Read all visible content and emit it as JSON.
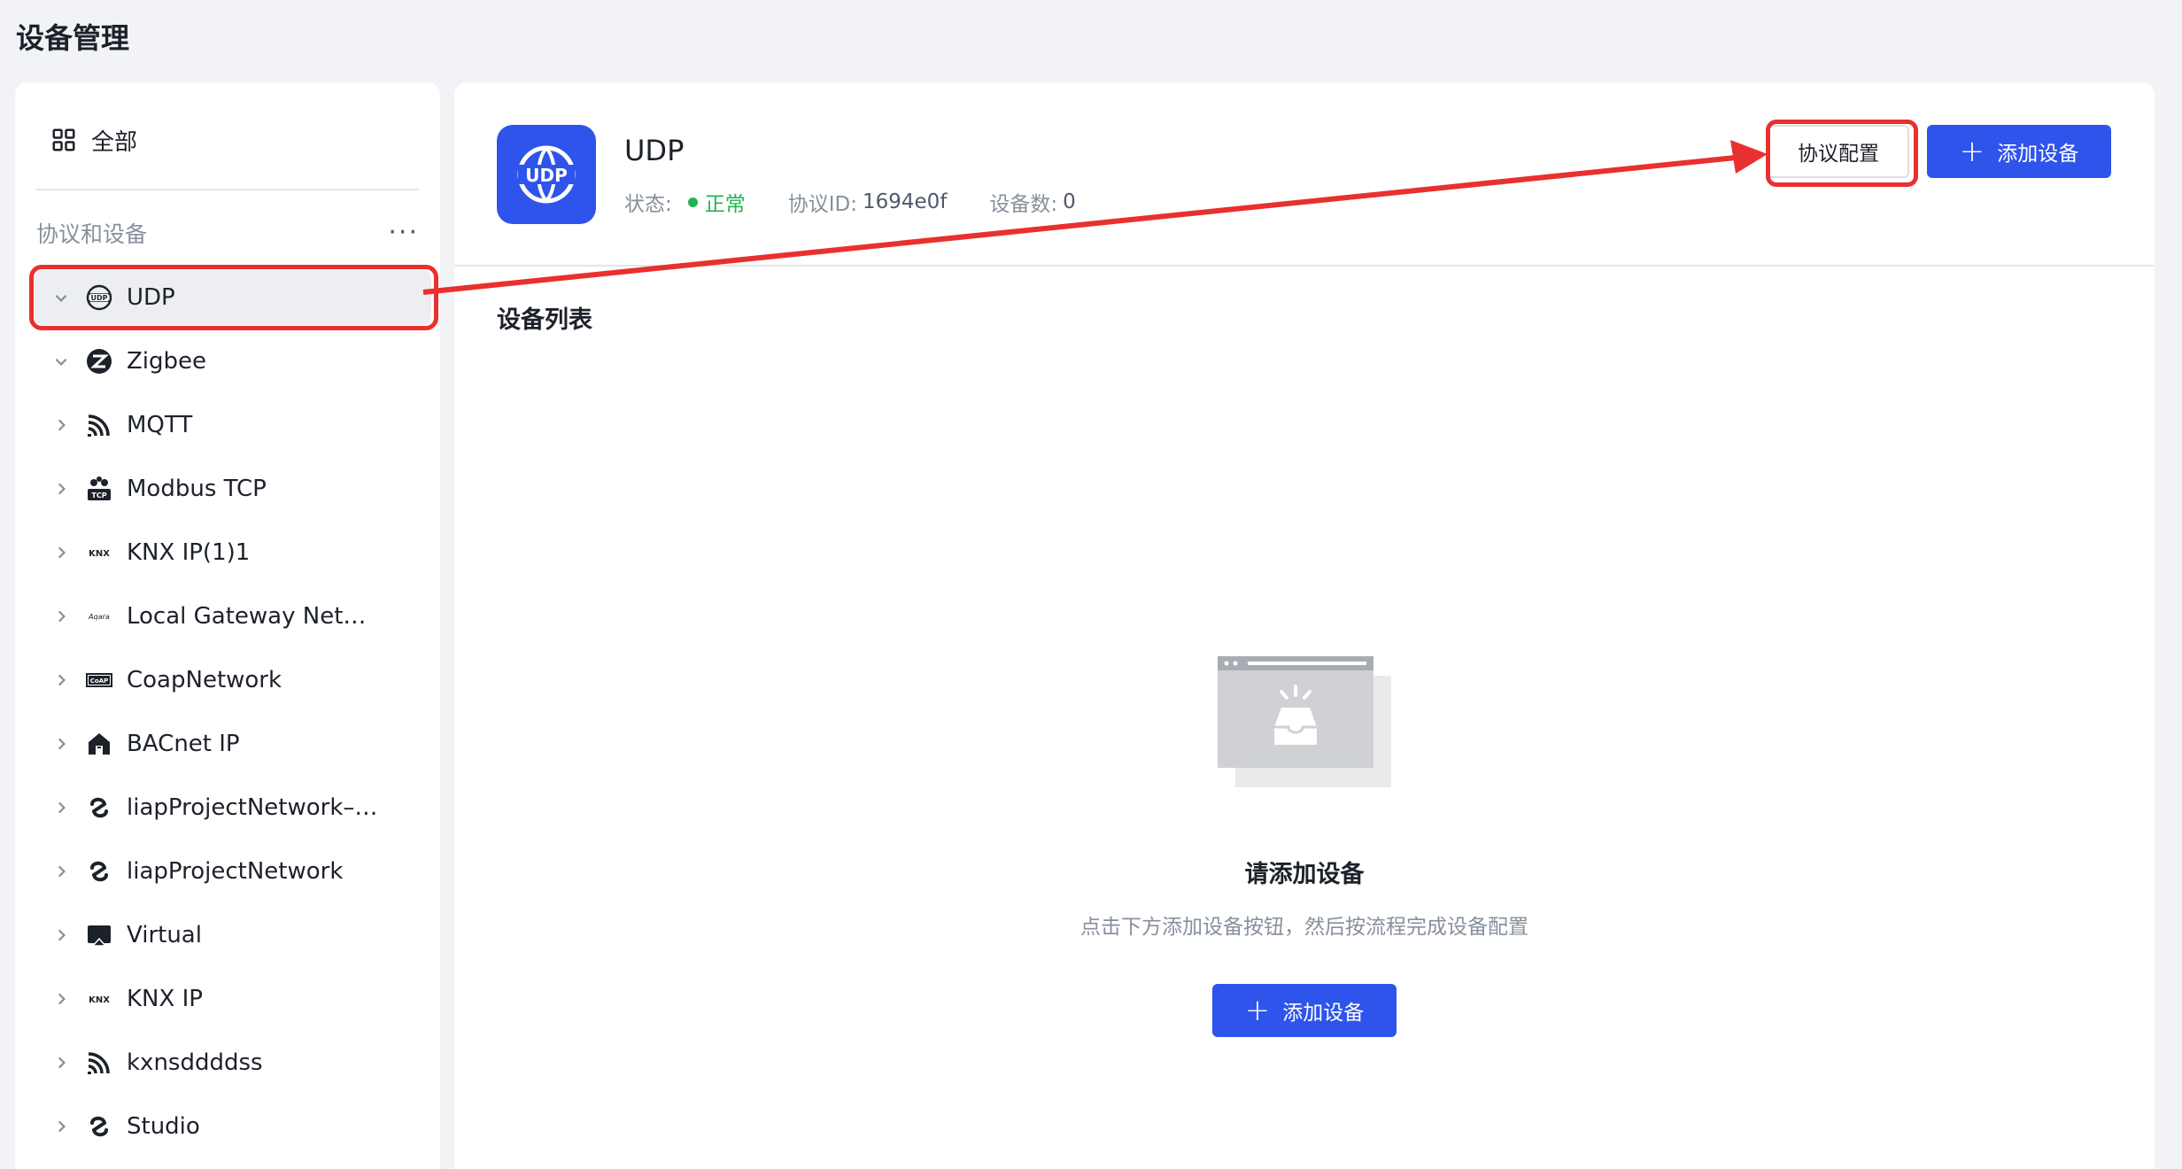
{
  "page": {
    "title": "设备管理"
  },
  "sidebar": {
    "all_label": "全部",
    "section_label": "协议和设备",
    "more": "···",
    "items": [
      {
        "label": "UDP",
        "icon": "udp-globe-icon",
        "expanded": true,
        "selected": true
      },
      {
        "label": "Zigbee",
        "icon": "zigbee-icon",
        "expanded": true,
        "selected": false
      },
      {
        "label": "MQTT",
        "icon": "mqtt-icon",
        "expanded": false,
        "selected": false
      },
      {
        "label": "Modbus TCP",
        "icon": "modbus-tcp-icon",
        "expanded": false,
        "selected": false
      },
      {
        "label": "KNX IP(1)1",
        "icon": "knx-icon",
        "expanded": false,
        "selected": false
      },
      {
        "label": "Local Gateway Net…",
        "icon": "aqara-icon",
        "expanded": false,
        "selected": false
      },
      {
        "label": "CoapNetwork",
        "icon": "coap-icon",
        "expanded": false,
        "selected": false
      },
      {
        "label": "BACnet IP",
        "icon": "bacnet-icon",
        "expanded": false,
        "selected": false
      },
      {
        "label": "liapProjectNetwork–…",
        "icon": "liap-icon",
        "expanded": false,
        "selected": false
      },
      {
        "label": "liapProjectNetwork",
        "icon": "liap-icon",
        "expanded": false,
        "selected": false
      },
      {
        "label": "Virtual",
        "icon": "virtual-icon",
        "expanded": false,
        "selected": false
      },
      {
        "label": "KNX IP",
        "icon": "knx-icon",
        "expanded": false,
        "selected": false
      },
      {
        "label": "kxnsddddss",
        "icon": "mqtt-icon",
        "expanded": false,
        "selected": false
      },
      {
        "label": "Studio",
        "icon": "liap-icon",
        "expanded": false,
        "selected": false
      }
    ]
  },
  "header": {
    "protocol_name": "UDP",
    "logo_text": "UDP",
    "status_label": "状态:",
    "status_value": "正常",
    "protocol_id_label": "协议ID:",
    "protocol_id_value": "1694e0f",
    "device_count_label": "设备数:",
    "device_count_value": "0",
    "config_button": "协议配置",
    "add_button": "添加设备"
  },
  "device_list": {
    "title": "设备列表",
    "empty_title": "请添加设备",
    "empty_desc": "点击下方添加设备按钮，然后按流程完成设备配置",
    "add_button": "添加设备"
  },
  "colors": {
    "primary": "#2f54eb",
    "status_ok": "#23b250",
    "annotation": "#e8302f"
  }
}
